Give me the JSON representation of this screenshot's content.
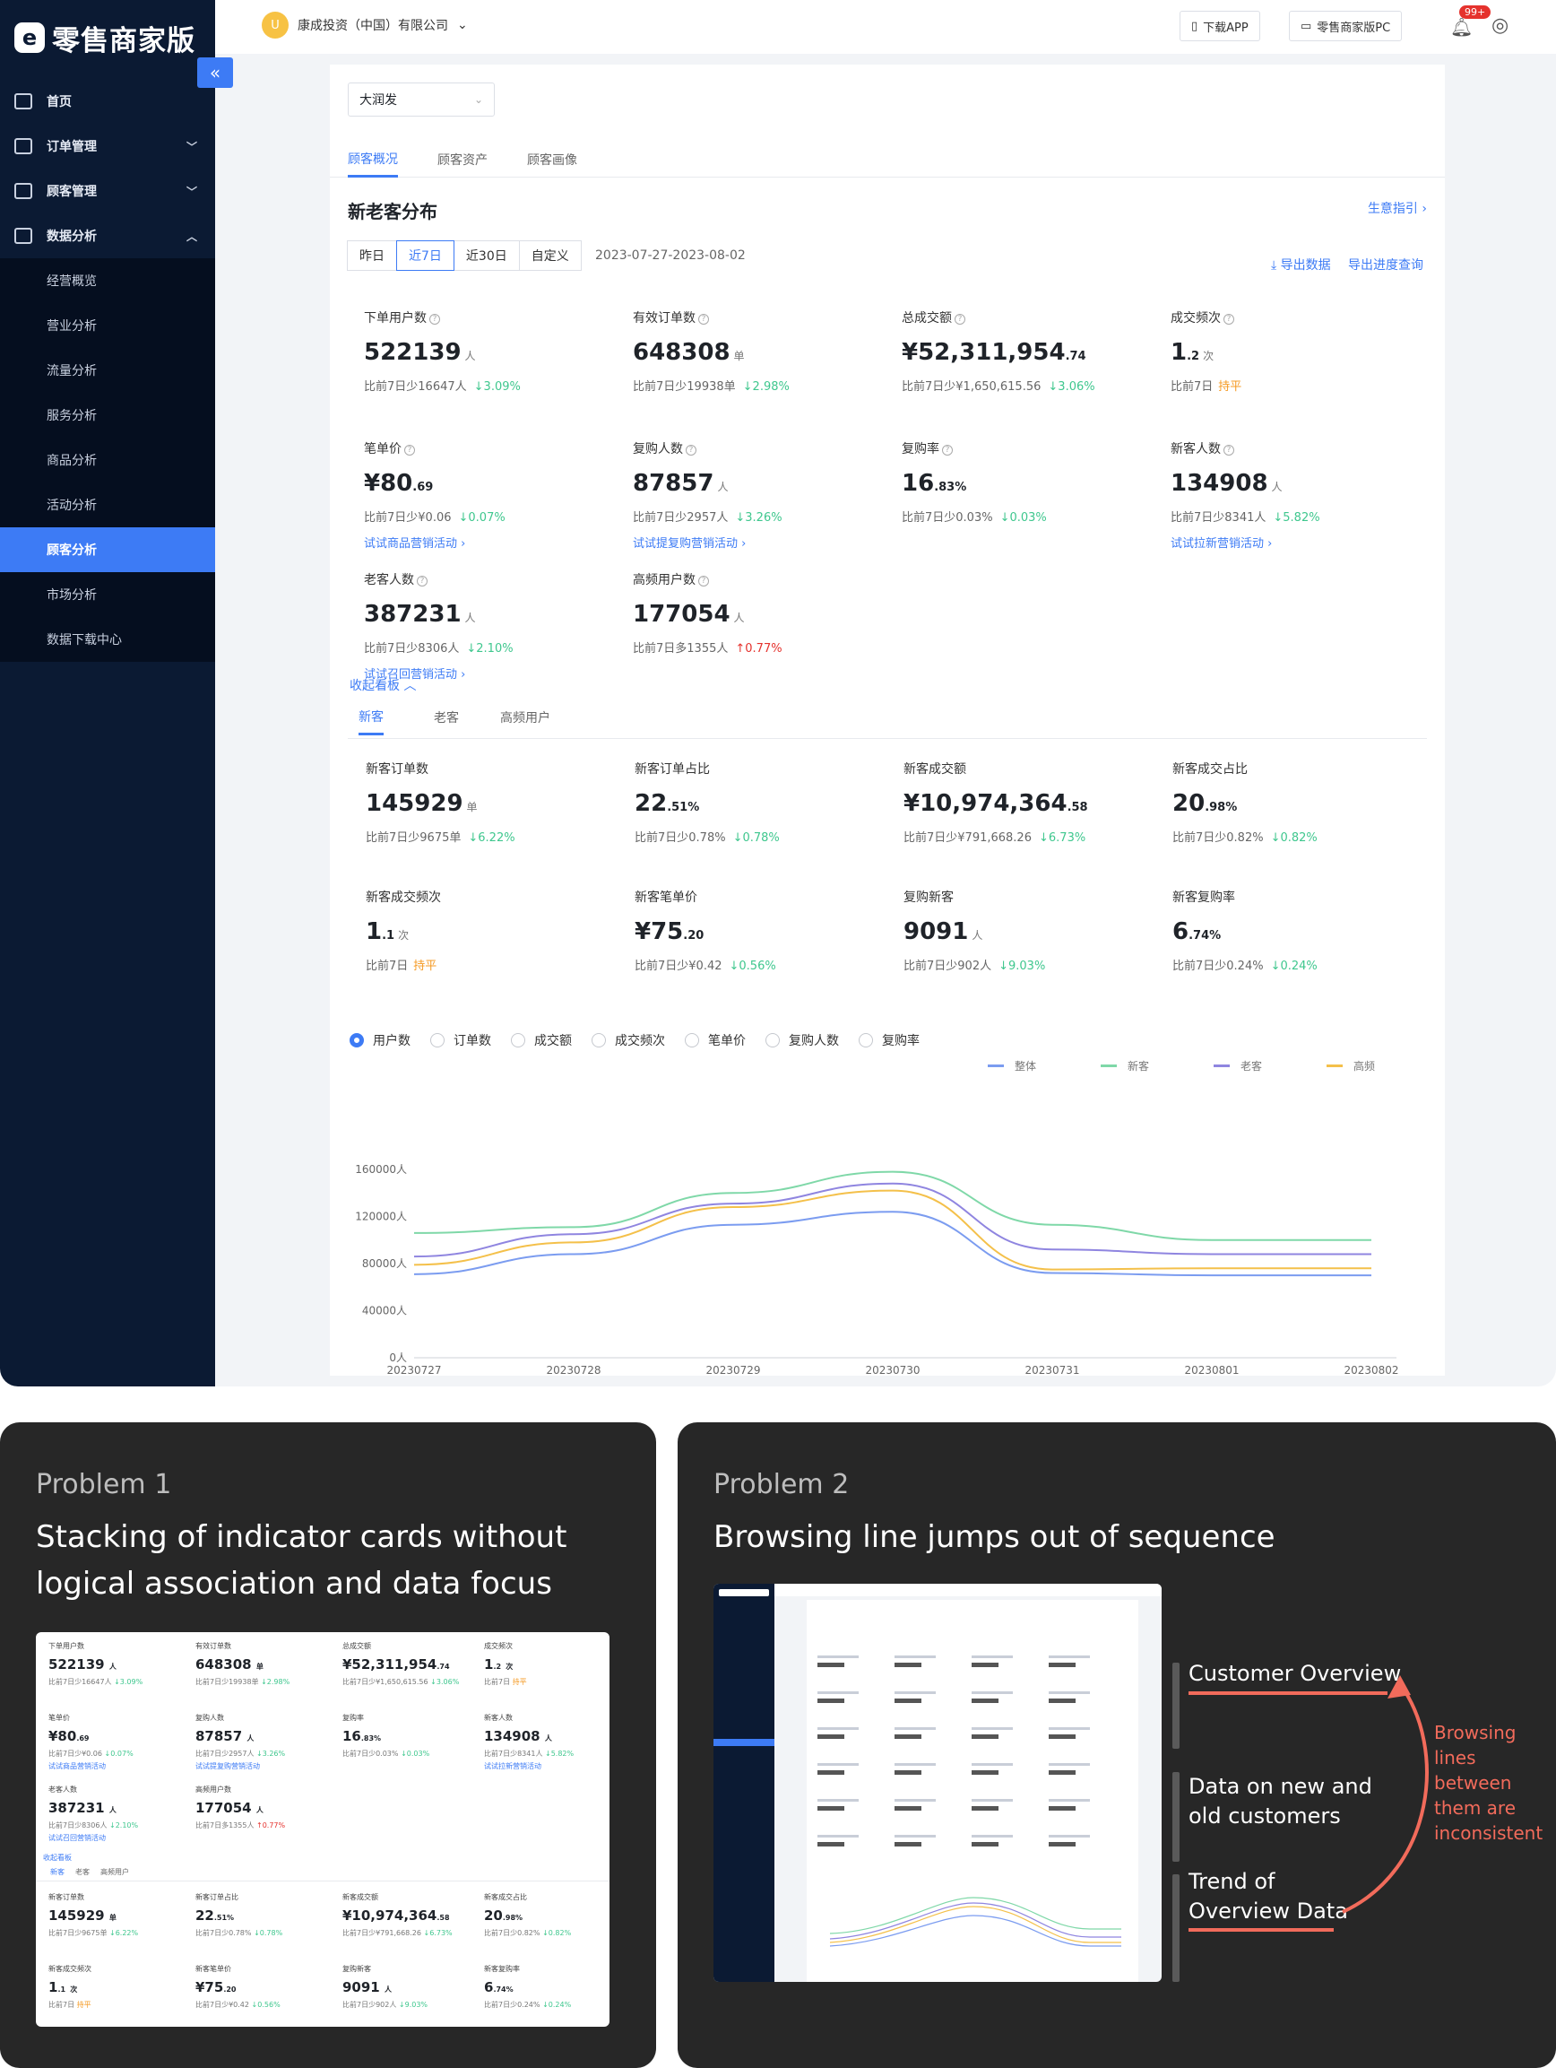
{
  "app": {
    "brand": "零售商家版",
    "brand_logo": "e",
    "company": "康成投资（中国）有限公司",
    "company_avatar": "U",
    "top_buttons": [
      "下载APP",
      "零售商家版PC"
    ],
    "notif_badge": "99+",
    "nav": [
      {
        "label": "首页",
        "expandable": false
      },
      {
        "label": "订单管理",
        "expandable": true
      },
      {
        "label": "顾客管理",
        "expandable": true
      },
      {
        "label": "数据分析",
        "expandable": true,
        "expanded": true
      }
    ],
    "subnav": [
      "经营概览",
      "营业分析",
      "流量分析",
      "服务分析",
      "商品分析",
      "活动分析",
      "顾客分析",
      "市场分析",
      "数据下载中心"
    ],
    "subnav_active": "顾客分析",
    "store": "大润发",
    "tabs": [
      "顾客概况",
      "顾客资产",
      "顾客画像"
    ],
    "active_tab": "顾客概况",
    "section_title": "新老客分布",
    "guide_link": "生意指引",
    "date_options": [
      "昨日",
      "近7日",
      "近30日",
      "自定义"
    ],
    "active_date": "近7日",
    "date_range": "2023-07-27-2023-08-02",
    "export_data": "导出数据",
    "export_progress": "导出进度查询",
    "fold_link": "收起看板",
    "sub_tabs": [
      "新客",
      "老客",
      "高频用户"
    ],
    "active_sub_tab": "新客"
  },
  "kpis": [
    {
      "label": "下单用户数",
      "int": "522139",
      "dec": "",
      "unit": "人",
      "cmp": "比前7日少16647人",
      "delta": "3.09%",
      "dir": "down",
      "link": ""
    },
    {
      "label": "有效订单数",
      "int": "648308",
      "dec": "",
      "unit": "单",
      "cmp": "比前7日少19938单",
      "delta": "2.98%",
      "dir": "down",
      "link": ""
    },
    {
      "label": "总成交额",
      "int": "¥52,311,954",
      "dec": ".74",
      "unit": "",
      "cmp": "比前7日少¥1,650,615.56",
      "delta": "3.06%",
      "dir": "down",
      "link": ""
    },
    {
      "label": "成交频次",
      "int": "1",
      "dec": ".2",
      "unit": "次",
      "cmp": "比前7日",
      "delta": "持平",
      "dir": "flat",
      "link": ""
    },
    {
      "label": "笔单价",
      "int": "¥80",
      "dec": ".69",
      "unit": "",
      "cmp": "比前7日少¥0.06",
      "delta": "0.07%",
      "dir": "down",
      "link": "试试商品营销活动"
    },
    {
      "label": "复购人数",
      "int": "87857",
      "dec": "",
      "unit": "人",
      "cmp": "比前7日少2957人",
      "delta": "3.26%",
      "dir": "down",
      "link": "试试提复购营销活动"
    },
    {
      "label": "复购率",
      "int": "16",
      "dec": ".83%",
      "unit": "",
      "cmp": "比前7日少0.03%",
      "delta": "0.03%",
      "dir": "down",
      "link": ""
    },
    {
      "label": "新客人数",
      "int": "134908",
      "dec": "",
      "unit": "人",
      "cmp": "比前7日少8341人",
      "delta": "5.82%",
      "dir": "down",
      "link": "试试拉新营销活动"
    },
    {
      "label": "老客人数",
      "int": "387231",
      "dec": "",
      "unit": "人",
      "cmp": "比前7日少8306人",
      "delta": "2.10%",
      "dir": "down",
      "link": "试试召回营销活动"
    },
    {
      "label": "高频用户数",
      "int": "177054",
      "dec": "",
      "unit": "人",
      "cmp": "比前7日多1355人",
      "delta": "0.77%",
      "dir": "up",
      "link": ""
    }
  ],
  "new_kpis": [
    {
      "label": "新客订单数",
      "int": "145929",
      "dec": "",
      "unit": "单",
      "cmp": "比前7日少9675单",
      "delta": "6.22%",
      "dir": "down"
    },
    {
      "label": "新客订单占比",
      "int": "22",
      "dec": ".51%",
      "unit": "",
      "cmp": "比前7日少0.78%",
      "delta": "0.78%",
      "dir": "down"
    },
    {
      "label": "新客成交额",
      "int": "¥10,974,364",
      "dec": ".58",
      "unit": "",
      "cmp": "比前7日少¥791,668.26",
      "delta": "6.73%",
      "dir": "down"
    },
    {
      "label": "新客成交占比",
      "int": "20",
      "dec": ".98%",
      "unit": "",
      "cmp": "比前7日少0.82%",
      "delta": "0.82%",
      "dir": "down"
    },
    {
      "label": "新客成交频次",
      "int": "1",
      "dec": ".1",
      "unit": "次",
      "cmp": "比前7日",
      "delta": "持平",
      "dir": "flat"
    },
    {
      "label": "新客笔单价",
      "int": "¥75",
      "dec": ".20",
      "unit": "",
      "cmp": "比前7日少¥0.42",
      "delta": "0.56%",
      "dir": "down"
    },
    {
      "label": "复购新客",
      "int": "9091",
      "dec": "",
      "unit": "人",
      "cmp": "比前7日少902人",
      "delta": "9.03%",
      "dir": "down"
    },
    {
      "label": "新客复购率",
      "int": "6",
      "dec": ".74%",
      "unit": "",
      "cmp": "比前7日少0.24%",
      "delta": "0.24%",
      "dir": "down"
    }
  ],
  "metric_radios": [
    "用户数",
    "订单数",
    "成交额",
    "成交频次",
    "笔单价",
    "复购人数",
    "复购率"
  ],
  "metric_active": "用户数",
  "colors": {
    "accent": "#3d7bf5",
    "down": "#3fc78e",
    "up": "#e5322d",
    "flat": "#f59a23",
    "sidebar": "#0b1a33",
    "problem_accent": "#f26b5b"
  },
  "chart_data": {
    "type": "line",
    "x": [
      "20230727",
      "20230728",
      "20230729",
      "20230730",
      "20230731",
      "20230801",
      "20230802"
    ],
    "ylim": [
      0,
      160000
    ],
    "yticks": [
      "0人",
      "40000人",
      "80000人",
      "120000人",
      "160000人"
    ],
    "grid": false,
    "legend_position": "top-right",
    "series": [
      {
        "name": "整体",
        "color": "#7b9cf0",
        "values": [
          71000,
          88000,
          113000,
          124000,
          72000,
          70000,
          70000
        ]
      },
      {
        "name": "新客",
        "color": "#7fd8a8",
        "values": [
          106000,
          111000,
          140000,
          158000,
          113000,
          100000,
          100000
        ]
      },
      {
        "name": "老客",
        "color": "#8f85e0",
        "values": [
          86000,
          105000,
          131000,
          148000,
          92000,
          88000,
          88000
        ]
      },
      {
        "name": "高频",
        "color": "#f4c04a",
        "values": [
          79000,
          98000,
          128000,
          142000,
          75000,
          76000,
          76000
        ]
      }
    ]
  },
  "problems": {
    "p1_num": "Problem 1",
    "p1_title_l1": "Stacking of indicator cards without",
    "p1_title_l2": "logical association and data focus",
    "p2_num": "Problem 2",
    "p2_title": "Browsing line jumps out of sequence",
    "flow": [
      "Customer Overview",
      "Data on new and old customers",
      "Trend of Overview Data"
    ],
    "note": [
      "Browsing",
      "lines",
      "between",
      "them are",
      "inconsistent"
    ]
  }
}
